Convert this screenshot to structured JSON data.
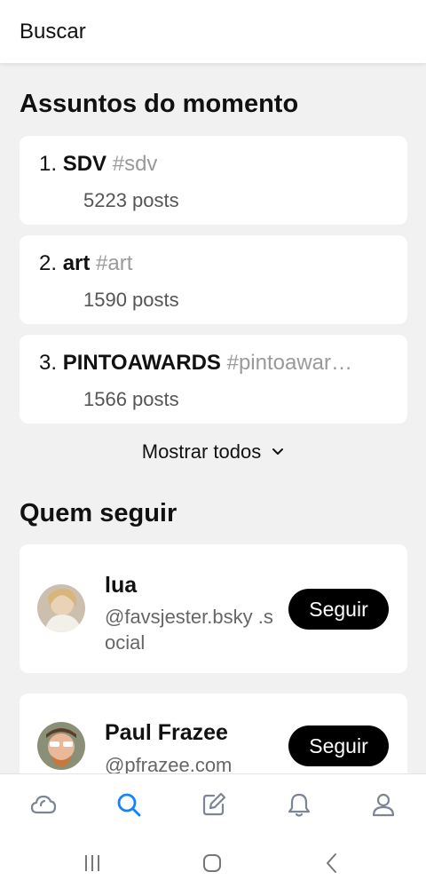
{
  "header": {
    "title": "Buscar"
  },
  "trending": {
    "title": "Assuntos do momento",
    "items": [
      {
        "rank": "1.",
        "name": "SDV",
        "tag": "#sdv",
        "count": "5223 posts"
      },
      {
        "rank": "2.",
        "name": "art",
        "tag": "#art",
        "count": "1590 posts"
      },
      {
        "rank": "3.",
        "name": "PINTOAWARDS",
        "tag": "#pintoawar…",
        "count": "1566 posts"
      }
    ],
    "show_all": "Mostrar todos"
  },
  "who_to_follow": {
    "title": "Quem seguir",
    "users": [
      {
        "name": "lua",
        "handle": "@favsjester.bsky .social",
        "button": "Seguir"
      },
      {
        "name": "Paul Frazee",
        "handle": "@pfrazee.com",
        "button": "Seguir"
      }
    ]
  },
  "tabbar": {
    "active": "search",
    "tabs": [
      "home-icon",
      "search-icon",
      "compose-icon",
      "notifications-icon",
      "profile-icon"
    ],
    "active_color": "#1083fe"
  },
  "system_nav": [
    "recent-apps-icon",
    "home-button-icon",
    "back-icon"
  ]
}
